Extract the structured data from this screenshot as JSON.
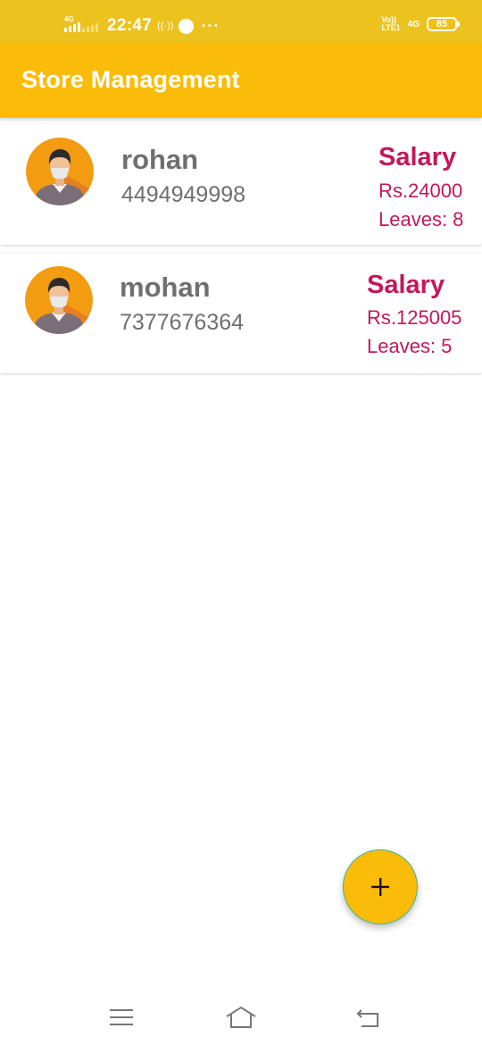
{
  "status_bar": {
    "network": "4G",
    "time": "22:47",
    "hotspot": "((·))",
    "dots": "···",
    "volte_top": "Vo))",
    "volte_bottom": "LTE1",
    "net_right": "4G",
    "battery": "85"
  },
  "app_bar": {
    "title": "Store Management"
  },
  "employees": [
    {
      "name": "rohan",
      "phone": "4494949998",
      "salary_label": "Salary",
      "salary": "Rs.24000",
      "leaves": "Leaves: 8"
    },
    {
      "name": "mohan",
      "phone": "7377676364",
      "salary_label": "Salary",
      "salary": "Rs.125005",
      "leaves": "Leaves: 5"
    }
  ],
  "fab": {
    "icon": "plus-icon"
  },
  "nav_bar": {
    "icons": [
      "menu-icon",
      "home-icon",
      "back-icon"
    ]
  },
  "colors": {
    "status_bar": "#ecc21f",
    "app_bar": "#fbbc09",
    "accent_text": "#c2185b",
    "primary_text": "#6f6f6f",
    "avatar_bg": "#f39c12"
  }
}
